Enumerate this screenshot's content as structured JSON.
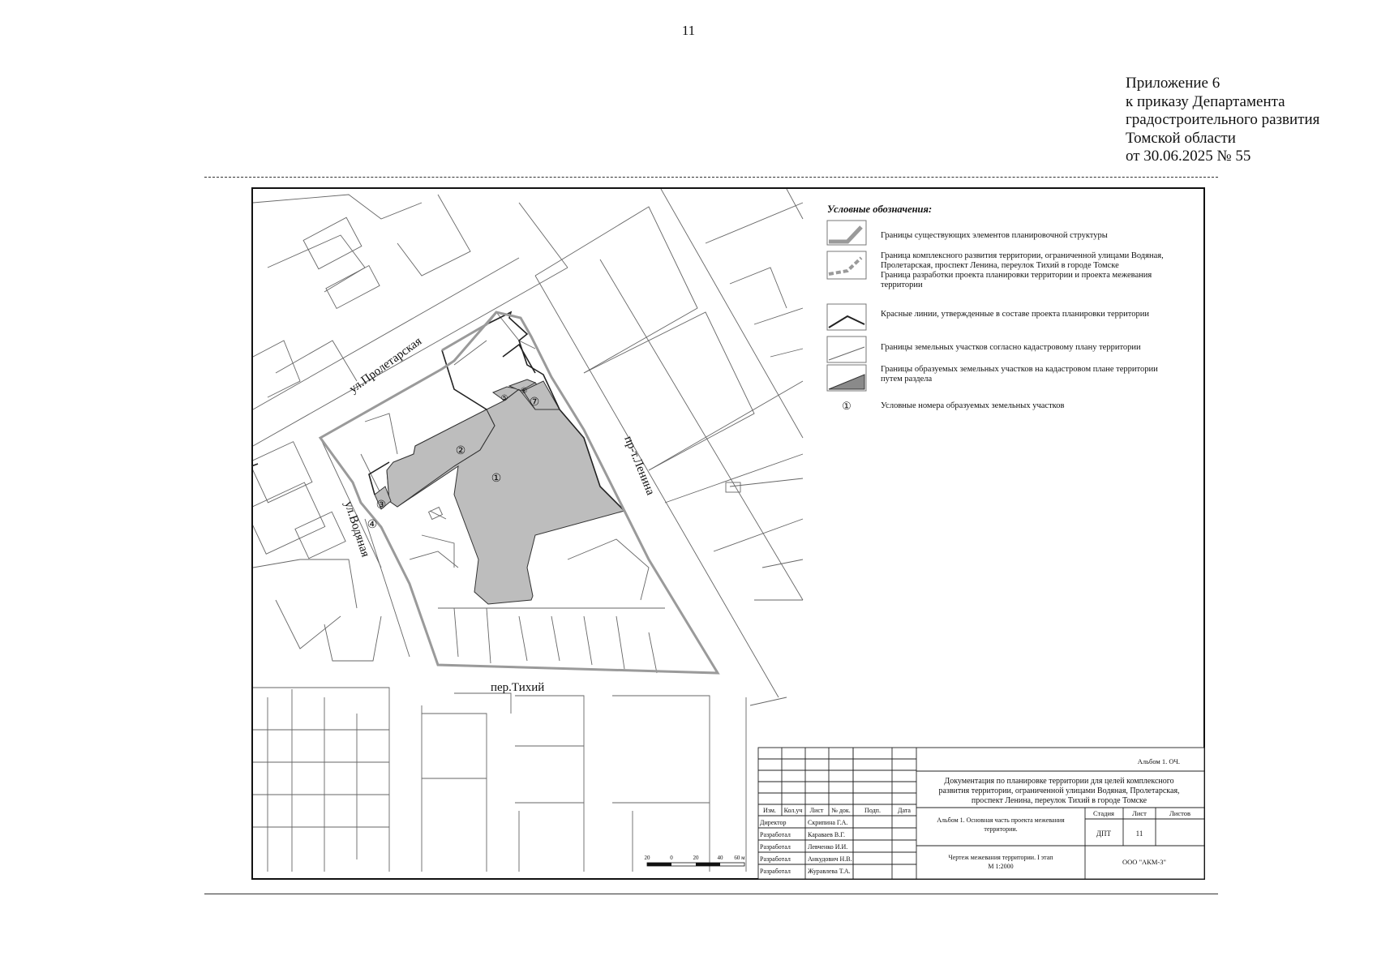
{
  "page_number": "11",
  "appendix": {
    "lines": [
      "Приложение 6",
      "к приказу Департамента",
      "градостроительного развития",
      "Томской области",
      "от 30.06.2025 № 55"
    ]
  },
  "legend": {
    "title": "Условные обозначения:",
    "items": [
      {
        "kind": "existing-boundary",
        "text": [
          "Границы существующих элементов планировочной структуры"
        ]
      },
      {
        "kind": "integrated-development-boundary",
        "text": [
          "Граница комплексного развития территории, ограниченной улицами Водяная,",
          "Пролетарская, проспект Ленина, переулок Тихий в городе Томске",
          "Граница разработки проекта планировки территории и проекта межевания",
          "территории"
        ]
      },
      {
        "kind": "red-lines",
        "text": [
          "Красные линии, утвержденные в составе проекта планировки территории"
        ]
      },
      {
        "kind": "cadastral-plots",
        "text": [
          "Границы земельных участков согласно кадастровому плану территории"
        ]
      },
      {
        "kind": "formed-plots",
        "text": [
          "Границы образуемых земельных участков на кадастровом плане территории",
          "путем раздела"
        ]
      },
      {
        "kind": "plot-number",
        "symbol": "①",
        "text": [
          "Условные номера образуемых земельных участков"
        ]
      }
    ]
  },
  "streets": {
    "proletarskaya": "ул.Пролетарская",
    "vodyanaya": "ул.Водяная",
    "lenina": "пр-т.Ленина",
    "tikhiy": "пер.Тихий"
  },
  "plot_numbers": [
    "①",
    "②",
    "③",
    "④",
    "⑤",
    "⑥",
    "⑦"
  ],
  "scale_bar": {
    "labels": [
      "20",
      "0",
      "20",
      "40",
      "60 м"
    ]
  },
  "title_block": {
    "album": "Альбом 1. ОЧ.",
    "document_title": [
      "Документация по планировке территории для целей комплексного",
      "развития территории, ограниченной улицами Водяная, Пролетарская,",
      "проспект Ленина, переулок Тихий в городе Томске"
    ],
    "headers": [
      "Изм.",
      "Кол.уч",
      "Лист",
      "№ док.",
      "Подп.",
      "Дата"
    ],
    "staff": [
      {
        "role": "Директор",
        "name": "Скрипина Г.А."
      },
      {
        "role": "Разработал",
        "name": "Караваев В.Г."
      },
      {
        "role": "Разработал",
        "name": "Левченко И.И."
      },
      {
        "role": "Разработал",
        "name": "Анкудович Н.В."
      },
      {
        "role": "Разработал",
        "name": "Журавлева Т.А."
      }
    ],
    "section": [
      "Альбом 1. Основная часть проекта межевания",
      "территории."
    ],
    "drawing": [
      "Чертеж межевания территории. I этап",
      "М 1:2000"
    ],
    "stage_header": "Стадия",
    "sheet_header": "Лист",
    "sheets_header": "Листов",
    "stage": "ДПТ",
    "sheet": "11",
    "sheets": "",
    "company": "ООО \"АКМ-3\""
  },
  "colors": {
    "formed_plot_fill": "#bdbdbd",
    "boundary_gray": "#9a9a9a",
    "line": "#222222"
  }
}
